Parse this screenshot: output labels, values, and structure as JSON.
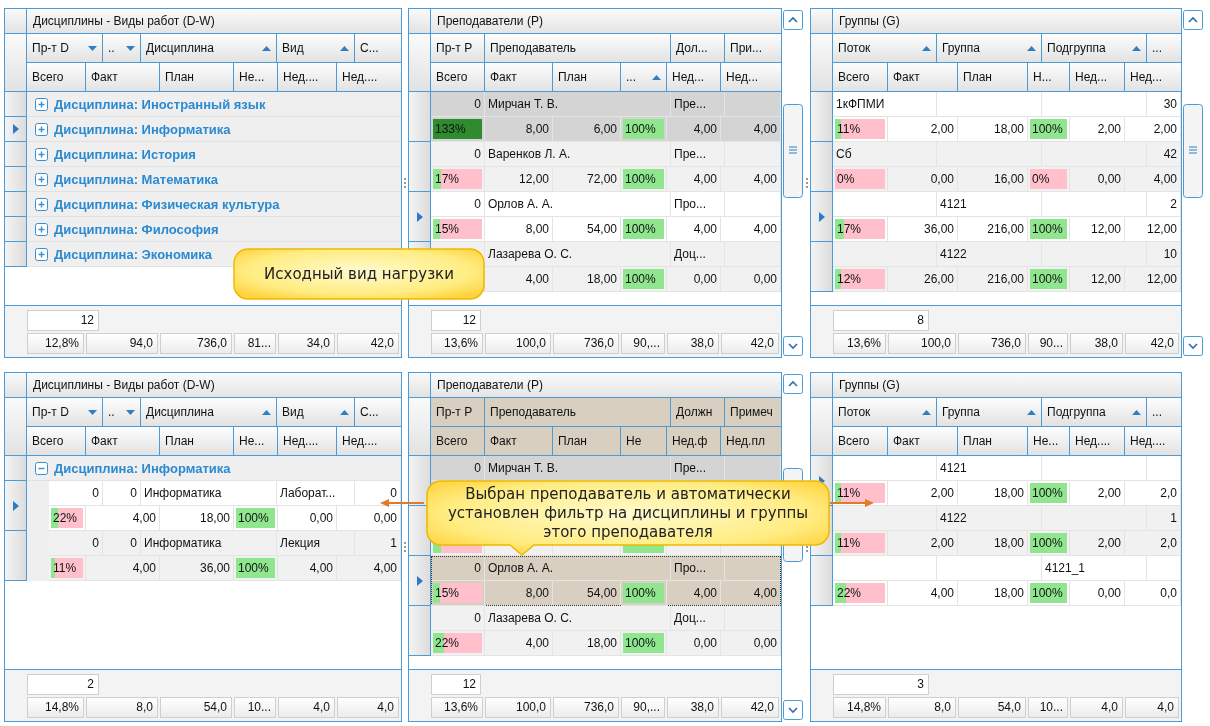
{
  "screens": [
    {
      "callout": {
        "text": "Исходный вид нагрузки"
      },
      "panels": [
        {
          "kind": "disciplines",
          "title": "Дисциплины - Виды работ (D-W)",
          "filtered": false,
          "scrollbar": false,
          "header_row_1": [
            {
              "label": "Пр-т D",
              "sort_ascending": false
            },
            {
              "label": "..",
              "sort_ascending": false
            },
            {
              "label": "Дисциплина",
              "sort_ascending": true
            },
            {
              "label": "Вид",
              "sort_ascending": true
            },
            {
              "label": "С..."
            }
          ],
          "header_row_2": [
            {
              "label": "Всего"
            },
            {
              "label": "Факт"
            },
            {
              "label": "План"
            },
            {
              "label": "Не..."
            },
            {
              "label": "Нед...."
            },
            {
              "label": "Нед...."
            }
          ],
          "rows": [
            {
              "kind": "group",
              "label": "Дисциплина: Иностранный язык",
              "expanded": false,
              "selected": false
            },
            {
              "kind": "group",
              "label": "Дисциплина: Информатика",
              "expanded": false,
              "selected": true
            },
            {
              "kind": "group",
              "label": "Дисциплина: История",
              "expanded": false,
              "selected": false
            },
            {
              "kind": "group",
              "label": "Дисциплина: Математика",
              "expanded": false,
              "selected": false
            },
            {
              "kind": "group",
              "label": "Дисциплина: Физическая культура",
              "expanded": false,
              "selected": false
            },
            {
              "kind": "group",
              "label": "Дисциплина: Философия",
              "expanded": false,
              "selected": false
            },
            {
              "kind": "group",
              "label": "Дисциплина: Экономика",
              "expanded": false,
              "selected": false
            }
          ],
          "footer": {
            "count": "12",
            "totals": [
              "12,8%",
              "94,0",
              "736,0",
              "81...",
              "34,0",
              "42,0"
            ]
          }
        },
        {
          "kind": "teachers",
          "title": "Преподаватели (P)",
          "filtered": false,
          "scrollbar": true,
          "header_row_1": [
            {
              "label": "Пр-т P"
            },
            {
              "label": "Преподаватель"
            },
            {
              "label": "Дол..."
            },
            {
              "label": "При..."
            }
          ],
          "header_row_2": [
            {
              "label": "Всего"
            },
            {
              "label": "Факт"
            },
            {
              "label": "План"
            },
            {
              "label": "...",
              "sort_ascending": true
            },
            {
              "label": "Нед..."
            },
            {
              "label": "Нед..."
            }
          ],
          "rows": [
            {
              "kind": "record",
              "selected": false,
              "shaded": true,
              "focused": false,
              "line_1": {
                "subject_total": "0",
                "teacher": "Мирчан Т. В.",
                "position": "Пре..."
              },
              "line_2": {
                "total": {
                  "text": "133%",
                  "level": 1,
                  "over": true
                },
                "fact": "8,00",
                "plan": "6,00",
                "share": {
                  "text": "100%",
                  "level": 1
                },
                "week_fact": "4,00",
                "week_plan": "4,00"
              }
            },
            {
              "kind": "record",
              "selected": false,
              "shaded": false,
              "focused": false,
              "line_1": {
                "subject_total": "0",
                "teacher": "Варенков Л. А.",
                "position": "Пре..."
              },
              "line_2": {
                "total": {
                  "text": "17%",
                  "level": 0.17
                },
                "fact": "12,00",
                "plan": "72,00",
                "share": {
                  "text": "100%",
                  "level": 1
                },
                "week_fact": "4,00",
                "week_plan": "4,00"
              }
            },
            {
              "kind": "record",
              "selected": true,
              "shaded": false,
              "focused": false,
              "line_1": {
                "subject_total": "0",
                "teacher": "Орлов А. А.",
                "position": "Про..."
              },
              "line_2": {
                "total": {
                  "text": "15%",
                  "level": 0.15
                },
                "fact": "8,00",
                "plan": "54,00",
                "share": {
                  "text": "100%",
                  "level": 1
                },
                "week_fact": "4,00",
                "week_plan": "4,00"
              }
            },
            {
              "kind": "record",
              "selected": false,
              "shaded": false,
              "focused": false,
              "line_1": {
                "teacher": "Лазарева О. С.",
                "position": "Доц..."
              },
              "line_2": {
                "fact": "4,00",
                "plan": "18,00",
                "share": {
                  "text": "100%",
                  "level": 1
                },
                "week_fact": "0,00",
                "week_plan": "0,00"
              }
            }
          ],
          "footer": {
            "count": "12",
            "totals": [
              "13,6%",
              "100,0",
              "736,0",
              "90,...",
              "38,0",
              "42,0"
            ]
          }
        },
        {
          "kind": "groups",
          "title": "Группы (G)",
          "filtered": false,
          "scrollbar": true,
          "header_row_1": [
            {
              "label": "Поток",
              "sort_ascending": true
            },
            {
              "label": "Группа",
              "sort_ascending": true
            },
            {
              "label": "Подгруппа",
              "sort_ascending": true
            },
            {
              "label": "..."
            }
          ],
          "header_row_2": [
            {
              "label": "Всего"
            },
            {
              "label": "Факт"
            },
            {
              "label": "План"
            },
            {
              "label": "Н..."
            },
            {
              "label": "Нед..."
            },
            {
              "label": "Нед..."
            }
          ],
          "rows": [
            {
              "kind": "record",
              "selected": false,
              "shaded": false,
              "focused": false,
              "line_1": {
                "stream": "1кФПМИ",
                "count": "30"
              },
              "line_2": {
                "total": {
                  "text": "11%",
                  "level": 0.11
                },
                "fact": "2,00",
                "plan": "18,00",
                "share": {
                  "text": "100%",
                  "level": 1
                },
                "week_fact": "2,00",
                "week_plan": "2,00"
              }
            },
            {
              "kind": "record",
              "selected": false,
              "shaded": false,
              "focused": false,
              "line_1": {
                "stream": "Сб",
                "count": "42"
              },
              "line_2": {
                "total": {
                  "text": "0%"
                },
                "fact": "0,00",
                "plan": "16,00",
                "share": {
                  "text": "0%"
                },
                "week_fact": "0,00",
                "week_plan": "4,00"
              }
            },
            {
              "kind": "record",
              "selected": true,
              "shaded": false,
              "focused": false,
              "line_1": {
                "group": "4121",
                "count": "2"
              },
              "line_2": {
                "total": {
                  "text": "17%",
                  "level": 0.17
                },
                "fact": "36,00",
                "plan": "216,00",
                "share": {
                  "text": "100%",
                  "level": 1
                },
                "week_fact": "12,00",
                "week_plan": "12,00"
              }
            },
            {
              "kind": "record",
              "selected": false,
              "shaded": false,
              "focused": false,
              "line_1": {
                "group": "4122",
                "count": "10"
              },
              "line_2": {
                "total": {
                  "text": "12%",
                  "level": 0.12
                },
                "fact": "26,00",
                "plan": "216,00",
                "share": {
                  "text": "100%",
                  "level": 1
                },
                "week_fact": "12,00",
                "week_plan": "12,00"
              }
            }
          ],
          "footer": {
            "count": "8",
            "totals": [
              "13,6%",
              "100,0",
              "736,0",
              "90...",
              "38,0",
              "42,0"
            ]
          }
        }
      ]
    },
    {
      "callout": {
        "text": "Выбран преподаватель и автоматически установлен фильтр на дисциплины и группы этого преподавателя",
        "pointer": true,
        "arrows": true
      },
      "panels": [
        {
          "kind": "disciplines",
          "title": "Дисциплины - Виды работ (D-W)",
          "filtered": false,
          "scrollbar": false,
          "header_row_1": [
            {
              "label": "Пр-т D",
              "sort_ascending": false
            },
            {
              "label": "..",
              "sort_ascending": false
            },
            {
              "label": "Дисциплина",
              "sort_ascending": true
            },
            {
              "label": "Вид",
              "sort_ascending": true
            },
            {
              "label": "С..."
            }
          ],
          "header_row_2": [
            {
              "label": "Всего"
            },
            {
              "label": "Факт"
            },
            {
              "label": "План"
            },
            {
              "label": "Не..."
            },
            {
              "label": "Нед...."
            },
            {
              "label": "Нед...."
            }
          ],
          "rows": [
            {
              "kind": "group",
              "label": "Дисциплина: Информатика",
              "expanded": true,
              "selected": false,
              "children": [
                {
                  "kind": "record",
                  "selected": true,
                  "shaded": false,
                  "focused": false,
                  "line_1": {
                    "subject_total": "0",
                    "column_2": "0",
                    "discipline": "Информатика",
                    "work_type": "Лаборат...",
                    "column_5": "0"
                  },
                  "line_2": {
                    "total": {
                      "text": "22%",
                      "level": 0.22
                    },
                    "fact": "4,00",
                    "plan": "18,00",
                    "share": {
                      "text": "100%",
                      "level": 1
                    },
                    "week_fact": "0,00",
                    "week_plan": "0,00"
                  }
                },
                {
                  "kind": "record",
                  "selected": false,
                  "shaded": false,
                  "focused": false,
                  "line_1": {
                    "subject_total": "0",
                    "column_2": "0",
                    "discipline": "Информатика",
                    "work_type": "Лекция",
                    "column_5": "1"
                  },
                  "line_2": {
                    "total": {
                      "text": "11%",
                      "level": 0.11
                    },
                    "fact": "4,00",
                    "plan": "36,00",
                    "share": {
                      "text": "100%",
                      "level": 1
                    },
                    "week_fact": "4,00",
                    "week_plan": "4,00"
                  }
                }
              ]
            }
          ],
          "footer": {
            "count": "2",
            "totals": [
              "14,8%",
              "8,0",
              "54,0",
              "10...",
              "4,0",
              "4,0"
            ]
          }
        },
        {
          "kind": "teachers",
          "title": "Преподаватели (P)",
          "filtered": true,
          "scrollbar": true,
          "header_row_1": [
            {
              "label": "Пр-т P"
            },
            {
              "label": "Преподаватель"
            },
            {
              "label": "Должн"
            },
            {
              "label": "Примеч"
            }
          ],
          "header_row_2": [
            {
              "label": "Всего"
            },
            {
              "label": "Факт"
            },
            {
              "label": "План"
            },
            {
              "label": "Не"
            },
            {
              "label": "Нед.ф"
            },
            {
              "label": "Нед.пл"
            }
          ],
          "rows": [
            {
              "kind": "record",
              "selected": false,
              "shaded": true,
              "focused": false,
              "line_1": {
                "subject_total": "0",
                "teacher": "Мирчан Т. В.",
                "position": "Пре..."
              },
              "line_2": {}
            },
            {
              "kind": "record",
              "selected": false,
              "shaded": false,
              "focused": false,
              "line_1": {},
              "line_2": {
                "total": {
                  "level": 0.17
                },
                "share": {
                  "level": 1
                }
              }
            },
            {
              "kind": "record",
              "selected": true,
              "shaded": false,
              "focused": true,
              "line_1": {
                "subject_total": "0",
                "teacher": "Орлов А. А.",
                "position": "Про..."
              },
              "line_2": {
                "total": {
                  "text": "15%",
                  "level": 0.15
                },
                "fact": "8,00",
                "plan": "54,00",
                "share": {
                  "text": "100%",
                  "level": 1
                },
                "week_fact": "4,00",
                "week_plan": "4,00"
              }
            },
            {
              "kind": "record",
              "selected": false,
              "shaded": false,
              "focused": false,
              "line_1": {
                "subject_total": "0",
                "teacher": "Лазарева О. С.",
                "position": "Доц..."
              },
              "line_2": {
                "total": {
                  "text": "22%",
                  "level": 0.22
                },
                "fact": "4,00",
                "plan": "18,00",
                "share": {
                  "text": "100%",
                  "level": 1
                },
                "week_fact": "0,00",
                "week_plan": "0,00"
              }
            }
          ],
          "footer": {
            "count": "12",
            "totals": [
              "13,6%",
              "100,0",
              "736,0",
              "90,...",
              "38,0",
              "42,0"
            ]
          }
        },
        {
          "kind": "groups",
          "title": "Группы (G)",
          "filtered": false,
          "scrollbar": false,
          "header_row_1": [
            {
              "label": "Поток",
              "sort_ascending": true
            },
            {
              "label": "Группа",
              "sort_ascending": true
            },
            {
              "label": "Подгруппа",
              "sort_ascending": true
            },
            {
              "label": "..."
            }
          ],
          "header_row_2": [
            {
              "label": "Всего"
            },
            {
              "label": "Факт"
            },
            {
              "label": "План"
            },
            {
              "label": "Не..."
            },
            {
              "label": "Нед...."
            },
            {
              "label": "Нед...."
            }
          ],
          "rows": [
            {
              "kind": "record",
              "selected": true,
              "shaded": false,
              "focused": false,
              "line_1": {
                "group": "4121"
              },
              "line_2": {
                "total": {
                  "text": "11%",
                  "level": 0.11
                },
                "fact": "2,00",
                "plan": "18,00",
                "share": {
                  "text": "100%",
                  "level": 1
                },
                "week_fact": "2,00",
                "week_plan": "2,0"
              }
            },
            {
              "kind": "record",
              "selected": false,
              "shaded": false,
              "focused": false,
              "line_1": {
                "group": "4122",
                "count": "1"
              },
              "line_2": {
                "total": {
                  "text": "11%",
                  "level": 0.11
                },
                "fact": "2,00",
                "plan": "18,00",
                "share": {
                  "text": "100%",
                  "level": 1
                },
                "week_fact": "2,00",
                "week_plan": "2,0"
              }
            },
            {
              "kind": "record",
              "selected": false,
              "shaded": false,
              "focused": false,
              "line_1": {
                "subgroup": "4121_1"
              },
              "line_2": {
                "total": {
                  "text": "22%",
                  "level": 0.22
                },
                "fact": "4,00",
                "plan": "18,00",
                "share": {
                  "text": "100%",
                  "level": 1
                },
                "week_fact": "0,00",
                "week_plan": "0,0"
              }
            }
          ],
          "footer": {
            "count": "3",
            "totals": [
              "14,8%",
              "8,0",
              "54,0",
              "10...",
              "4,0",
              "4,0"
            ]
          }
        }
      ]
    }
  ]
}
